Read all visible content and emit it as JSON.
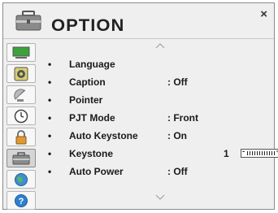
{
  "window": {
    "title": "OPTION"
  },
  "icons": {
    "header": "toolbox-icon",
    "close": "close-icon",
    "up": "chevron-up-icon",
    "down": "chevron-down-icon"
  },
  "sidebar": {
    "items": [
      {
        "icon": "monitor-icon"
      },
      {
        "icon": "speaker-icon"
      },
      {
        "icon": "satellite-dish-icon"
      },
      {
        "icon": "clock-icon"
      },
      {
        "icon": "lock-icon"
      },
      {
        "icon": "toolbox-icon",
        "active": true
      },
      {
        "icon": "globe-icon"
      },
      {
        "icon": "help-icon"
      }
    ]
  },
  "menu": {
    "bullet": "•",
    "items": [
      {
        "label": "Language",
        "value": ""
      },
      {
        "label": "Caption",
        "value": ": Off"
      },
      {
        "label": "Pointer",
        "value": ""
      },
      {
        "label": "PJT Mode",
        "value": ": Front"
      },
      {
        "label": "Auto Keystone",
        "value": ": On"
      },
      {
        "label": "Keystone",
        "value": "",
        "number": "1"
      },
      {
        "label": "Auto Power",
        "value": ": Off"
      }
    ]
  },
  "close_label": "×",
  "scroll": {
    "up": "^",
    "down": "v"
  },
  "slider": {
    "minus": "-",
    "plus": "+",
    "value": 1
  }
}
